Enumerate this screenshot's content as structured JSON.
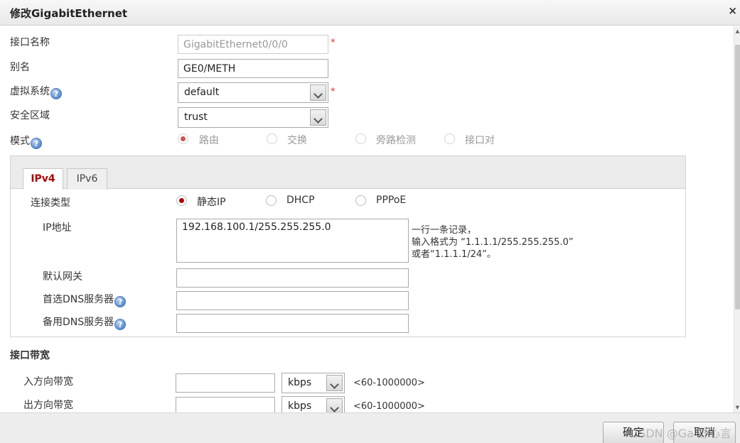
{
  "dialog": {
    "title": "修改GigabitEthernet",
    "close_glyph": "×"
  },
  "form": {
    "interface_name_label": "接口名称",
    "interface_name_value": "GigabitEthernet0/0/0",
    "required_mark": "*",
    "alias_label": "别名",
    "alias_value": "GE0/METH",
    "vsys_label": "虚拟系统",
    "vsys_value": "default",
    "zone_label": "安全区域",
    "zone_value": "trust",
    "mode_label": "模式",
    "mode_options": [
      "路由",
      "交换",
      "旁路检测",
      "接口对"
    ],
    "mode_selected": "路由",
    "help_glyph": "?"
  },
  "ip_panel": {
    "tabs": [
      "IPv4",
      "IPv6"
    ],
    "active_tab": "IPv4",
    "conn_type_label": "连接类型",
    "conn_type_options": [
      "静态IP",
      "DHCP",
      "PPPoE"
    ],
    "conn_type_selected": "静态IP",
    "ip_label": "IP地址",
    "ip_value": "192.168.100.1/255.255.255.0",
    "ip_hint": [
      "一行一条记录，",
      "输入格式为 “1.1.1.1/255.255.255.0”",
      "或者“1.1.1.1/24”。"
    ],
    "gateway_label": "默认网关",
    "gateway_value": "",
    "dns1_label": "首选DNS服务器",
    "dns1_value": "",
    "dns2_label": "备用DNS服务器",
    "dns2_value": ""
  },
  "bandwidth": {
    "section_title": "接口带宽",
    "inbound_label": "入方向带宽",
    "inbound_value": "",
    "inbound_unit": "kbps",
    "inbound_range": "<60-1000000>",
    "outbound_label": "出方向带宽",
    "outbound_value": "",
    "outbound_unit": "kbps",
    "outbound_range": "<60-1000000>"
  },
  "footer": {
    "ok_label": "确定",
    "cancel_label": "取消",
    "watermark": "CSDN @Ga 舒心言"
  },
  "colors": {
    "accent_red": "#b00000",
    "required_red": "#e03030",
    "help_blue": "#5b8ccf"
  }
}
